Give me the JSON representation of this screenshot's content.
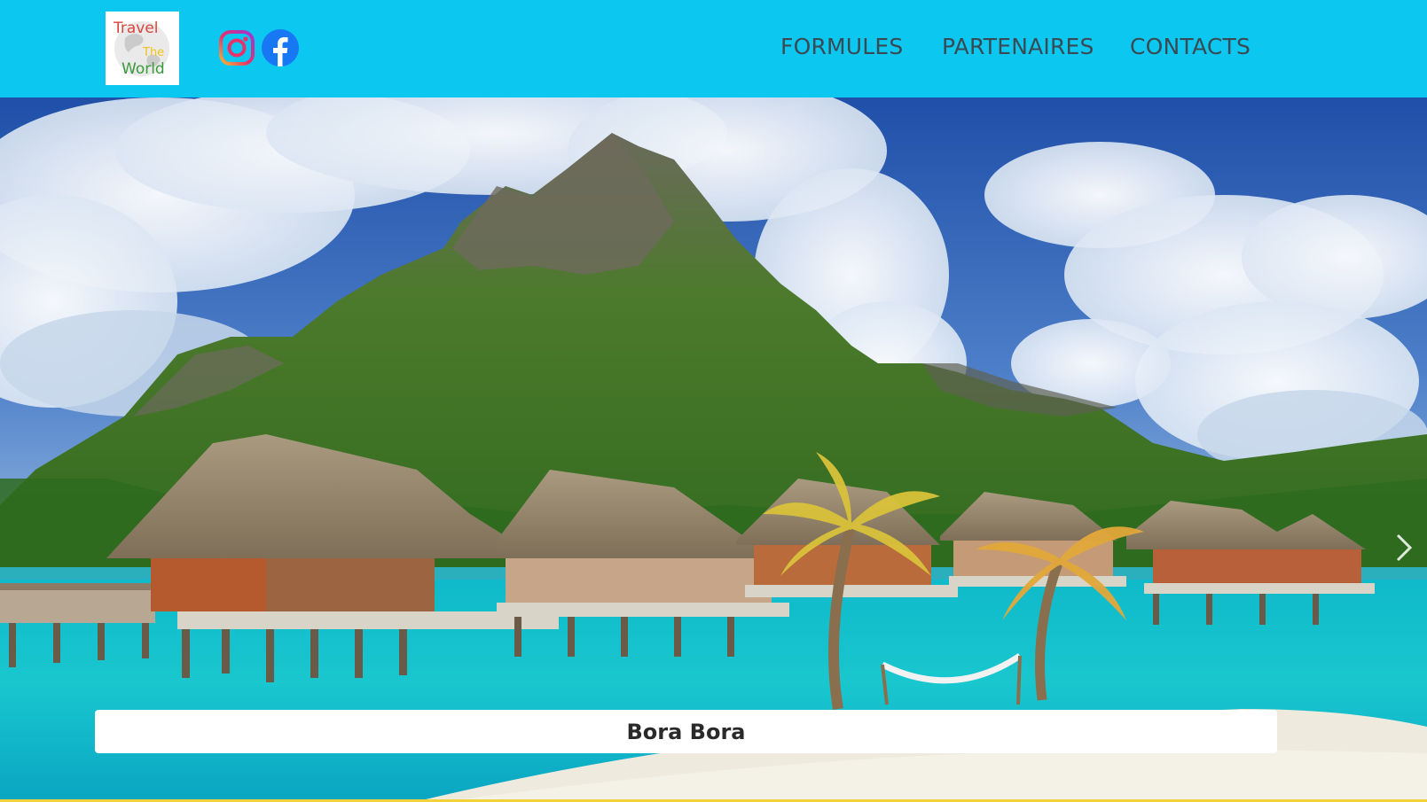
{
  "header": {
    "logo": {
      "alt": "Travel The World logo",
      "line1": "Travel",
      "line2": "The",
      "line3": "World"
    },
    "social": [
      {
        "name": "instagram",
        "icon": "instagram-icon"
      },
      {
        "name": "facebook",
        "icon": "facebook-icon"
      }
    ],
    "nav": [
      {
        "label": "FORMULES"
      },
      {
        "label": "PARTENAIRES"
      },
      {
        "label": "CONTACTS"
      }
    ]
  },
  "hero": {
    "slide_caption": "Bora Bora",
    "next_icon": "chevron-right-icon"
  },
  "colors": {
    "header_bg": "#0cc8f0",
    "nav_text": "#3a4a55",
    "caption_bg": "#ffffff",
    "bottom_accent": "#f2d23a"
  }
}
